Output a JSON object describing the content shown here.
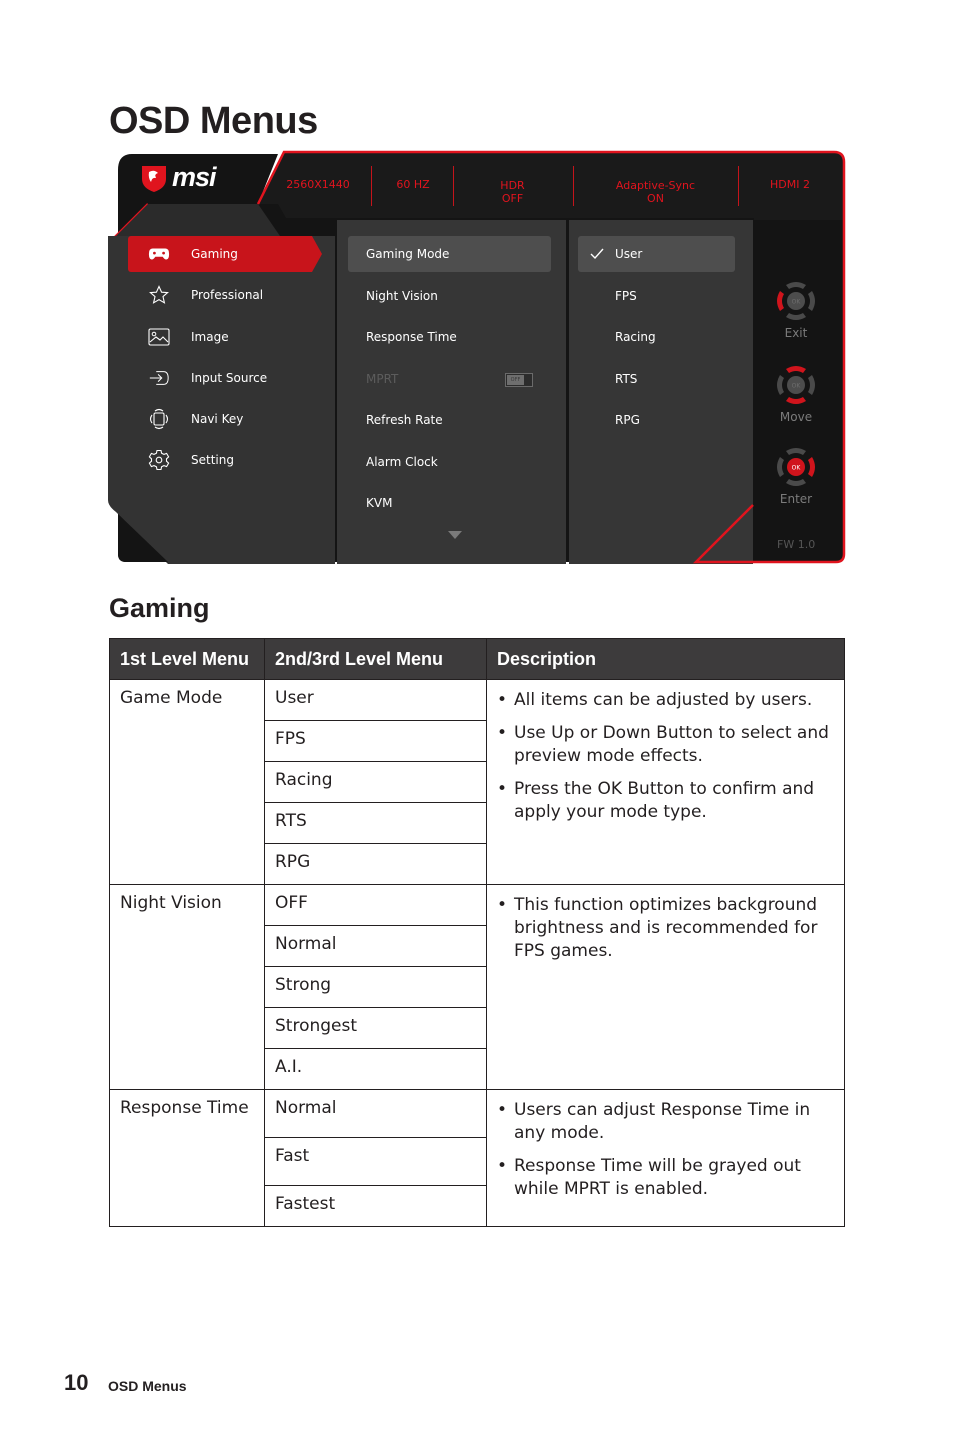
{
  "page": {
    "title": "OSD Menus",
    "section_title": "Gaming",
    "footer": {
      "page_number": "10",
      "label": "OSD Menus"
    }
  },
  "osd": {
    "brand": "msi",
    "status_bar": [
      {
        "id": "resolution",
        "text": "2560X1440"
      },
      {
        "id": "refresh",
        "text": "60 HZ"
      },
      {
        "id": "hdr",
        "text": "HDR\nOFF"
      },
      {
        "id": "adaptive_sync",
        "text": "Adaptive-Sync\nON"
      },
      {
        "id": "input",
        "text": "HDMI 2"
      }
    ],
    "accent_color": "#e0141e",
    "level1": [
      {
        "label": "Gaming",
        "icon": "gamepad-icon",
        "active": true
      },
      {
        "label": "Professional",
        "icon": "star-icon"
      },
      {
        "label": "Image",
        "icon": "image-icon"
      },
      {
        "label": "Input Source",
        "icon": "input-source-icon"
      },
      {
        "label": "Navi Key",
        "icon": "navi-key-icon"
      },
      {
        "label": "Setting",
        "icon": "gear-icon"
      }
    ],
    "level2": [
      {
        "label": "Gaming Mode",
        "active": true
      },
      {
        "label": "Night Vision"
      },
      {
        "label": "Response Time"
      },
      {
        "label": "MPRT",
        "disabled": true,
        "toggle": "OFF"
      },
      {
        "label": "Refresh Rate"
      },
      {
        "label": "Alarm Clock"
      },
      {
        "label": "KVM"
      }
    ],
    "level3": [
      {
        "label": "User",
        "selected": true
      },
      {
        "label": "FPS"
      },
      {
        "label": "Racing"
      },
      {
        "label": "RTS"
      },
      {
        "label": "RPG"
      }
    ],
    "keys": [
      {
        "label": "Exit",
        "ok": "OK"
      },
      {
        "label": "Move",
        "ok": "OK"
      },
      {
        "label": "Enter",
        "ok": "OK"
      }
    ],
    "firmware": "FW 1.0"
  },
  "table": {
    "headers": [
      "1st Level Menu",
      "2nd/3rd Level Menu",
      "Description"
    ],
    "groups": [
      {
        "level1": "Game Mode",
        "options": [
          "User",
          "FPS",
          "Racing",
          "RTS",
          "RPG"
        ],
        "description": [
          "All items can be adjusted by users.",
          "Use Up or Down Button to select and preview mode effects.",
          "Press the OK Button to confirm and apply your mode type."
        ]
      },
      {
        "level1": "Night Vision",
        "options": [
          "OFF",
          "Normal",
          "Strong",
          "Strongest",
          "A.I."
        ],
        "description": [
          "This function optimizes background brightness and is recommended for FPS games."
        ]
      },
      {
        "level1": "Response Time",
        "options": [
          "Normal",
          "Fast",
          "Fastest"
        ],
        "description": [
          "Users can adjust Response Time in any mode.",
          "Response Time will be grayed out while MPRT is enabled."
        ]
      }
    ]
  }
}
